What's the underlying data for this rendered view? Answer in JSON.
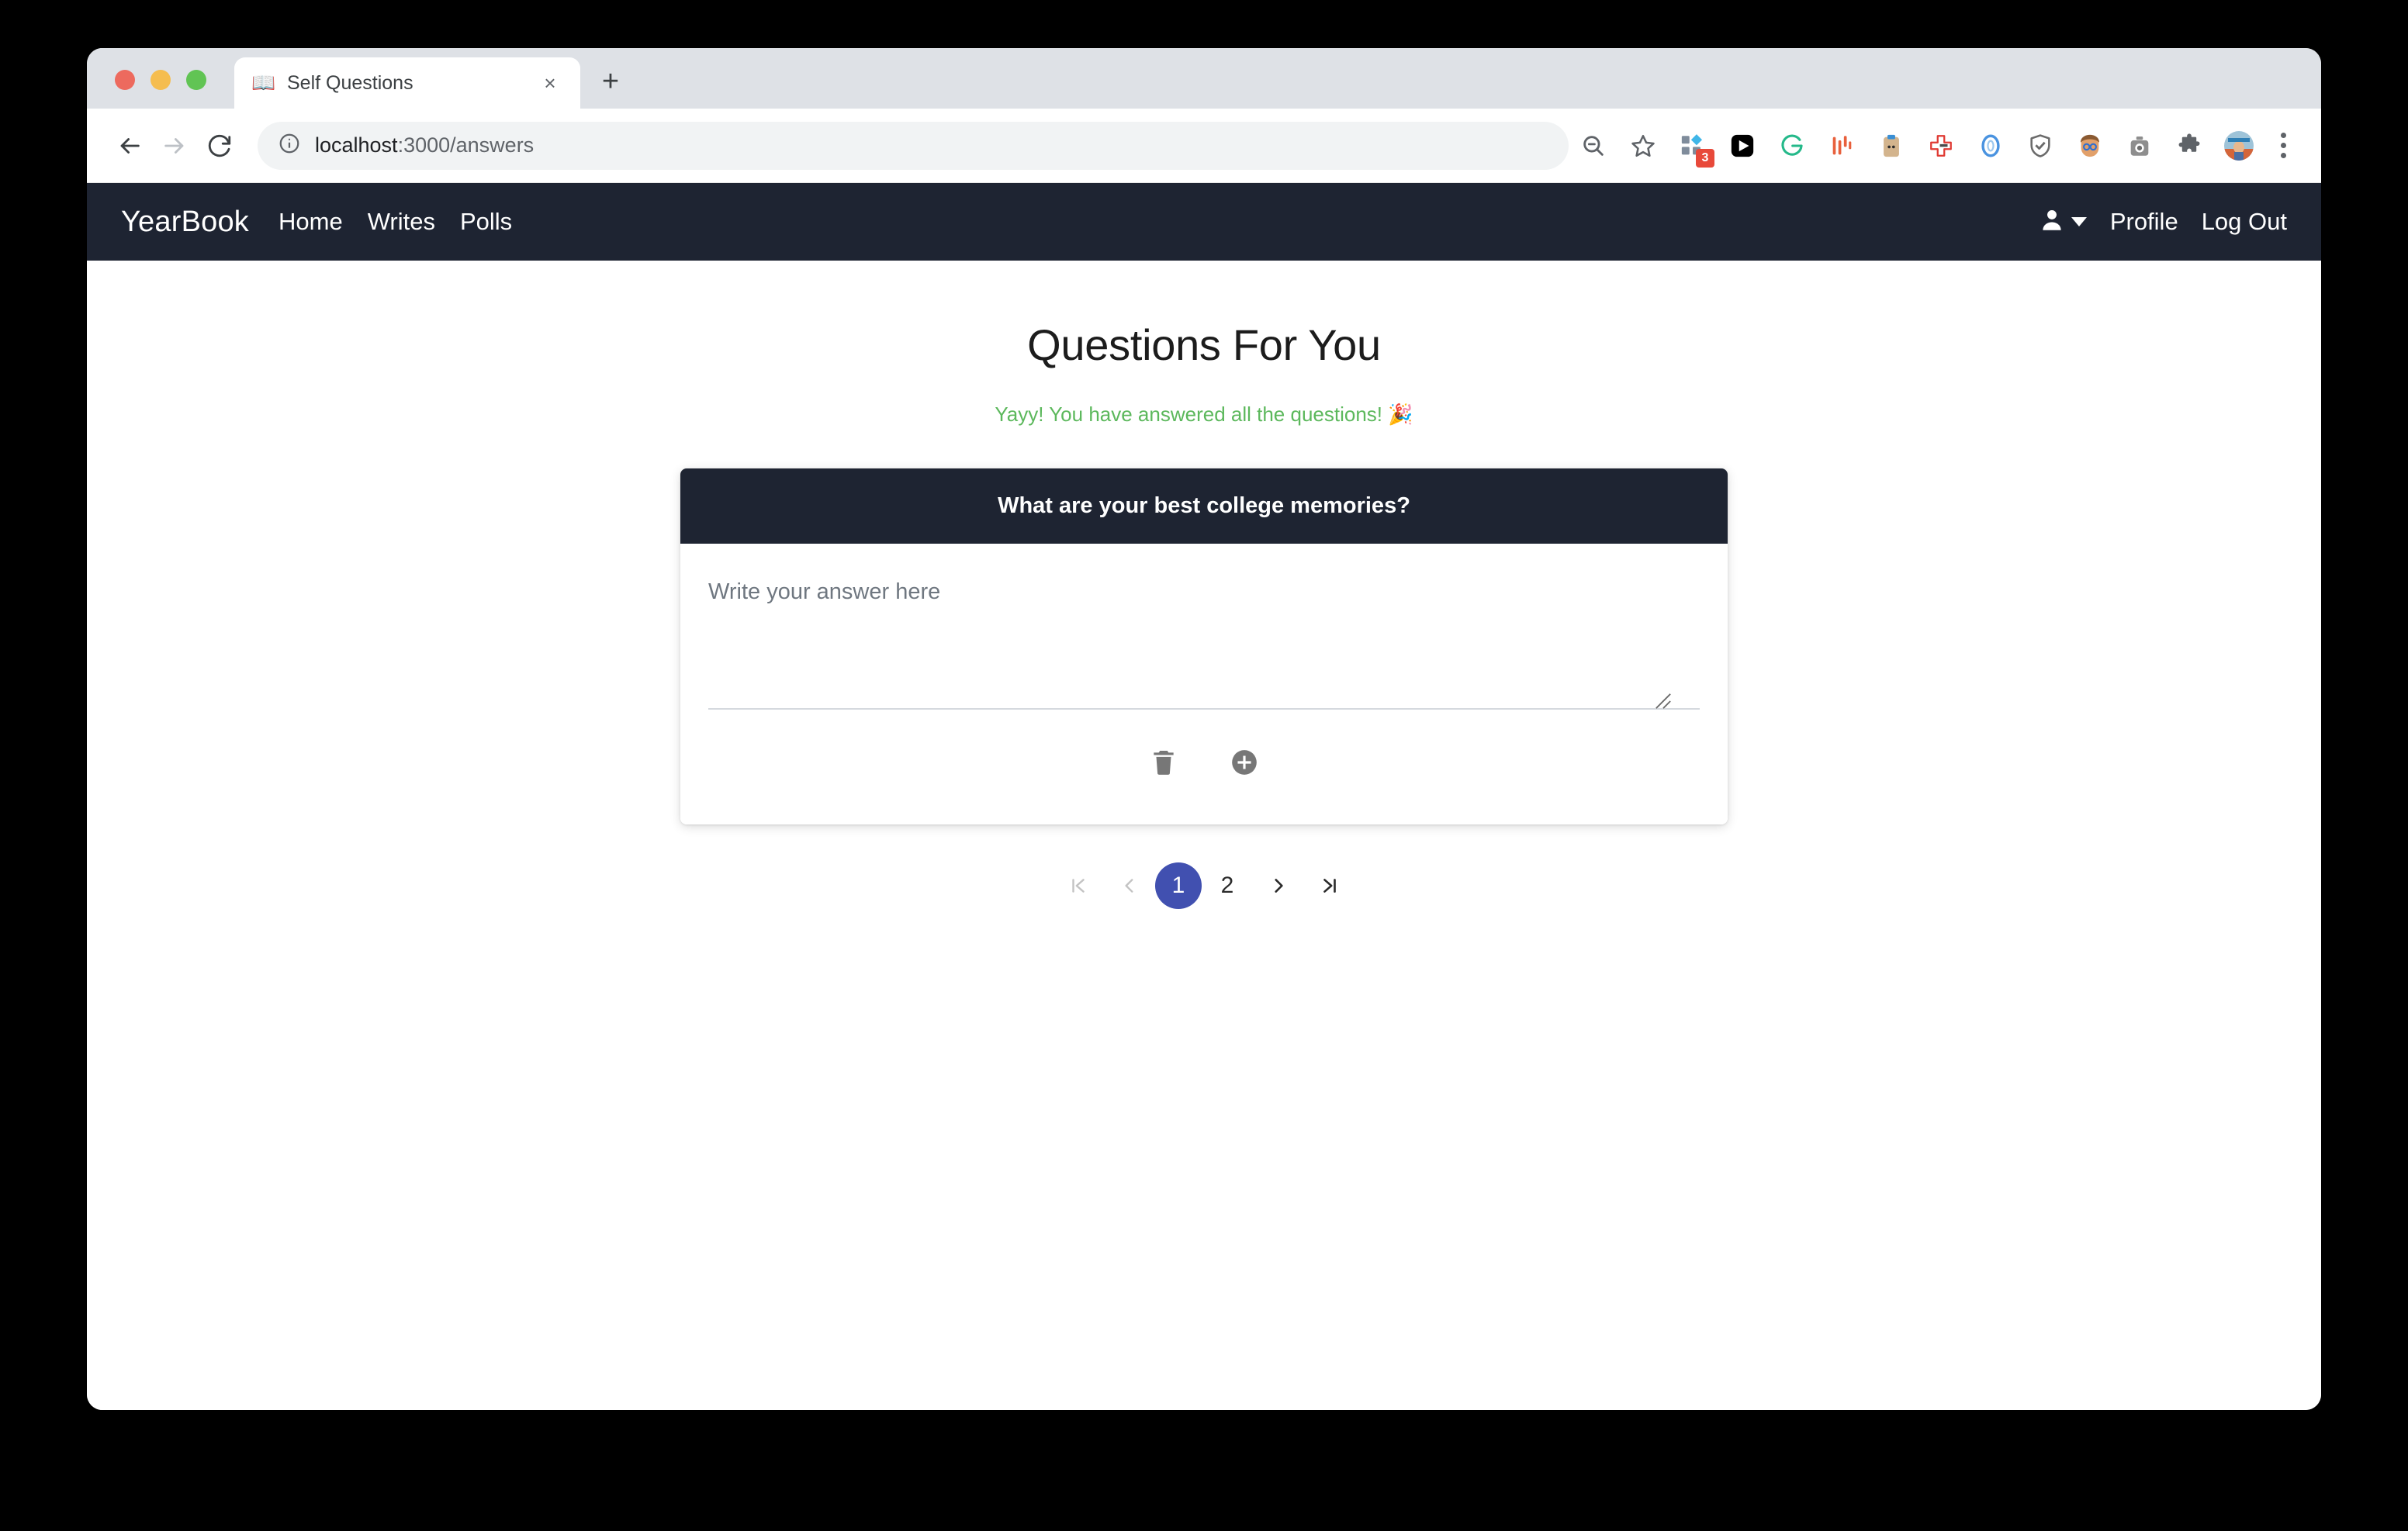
{
  "browser": {
    "traffic_lights": [
      "close",
      "minimize",
      "maximize"
    ],
    "tab": {
      "title": "Self Questions",
      "favicon": "📖",
      "close_label": "×"
    },
    "new_tab_label": "+",
    "back_icon": "back-arrow-icon",
    "forward_icon": "forward-arrow-icon",
    "reload_icon": "reload-icon",
    "omnibox": {
      "info_icon": "info-circle-icon",
      "host": "localhost",
      "path": ":3000/answers",
      "full_url": "localhost:3000/answers"
    },
    "extensions": [
      {
        "name": "zoom-out-icon",
        "glyph": "zoom"
      },
      {
        "name": "bookmark-star-icon",
        "glyph": "star"
      },
      {
        "name": "grid-extension-icon",
        "glyph": "grid",
        "badge": "3"
      },
      {
        "name": "video-play-extension-icon",
        "glyph": "play"
      },
      {
        "name": "grammarly-extension-icon",
        "glyph": "g"
      },
      {
        "name": "bars-extension-icon",
        "glyph": "bars"
      },
      {
        "name": "notes-extension-icon",
        "glyph": "notes"
      },
      {
        "name": "health-cross-extension-icon",
        "glyph": "cross"
      },
      {
        "name": "blue-ring-extension-icon",
        "glyph": "ring"
      },
      {
        "name": "shield-extension-icon",
        "glyph": "shield"
      },
      {
        "name": "face-avatar-extension-icon",
        "glyph": "face"
      },
      {
        "name": "camera-extension-icon",
        "glyph": "camera"
      },
      {
        "name": "puzzle-extensions-icon",
        "glyph": "puzzle"
      },
      {
        "name": "profile-avatar-icon",
        "glyph": "avatar"
      }
    ],
    "menu_icon": "three-dots-menu-icon"
  },
  "navbar": {
    "brand": "YearBook",
    "links": [
      {
        "label": "Home"
      },
      {
        "label": "Writes"
      },
      {
        "label": "Polls"
      }
    ],
    "user_icon": "user-person-icon",
    "profile_label": "Profile",
    "logout_label": "Log Out"
  },
  "main": {
    "title": "Questions For You",
    "success_message": "Yayy! You have answered all the questions! 🎉",
    "card": {
      "question": "What are your best college memories?",
      "answer_value": "",
      "answer_placeholder": "Write your answer here",
      "delete_icon": "trash-icon",
      "add_icon": "plus-circle-icon"
    }
  },
  "pagination": {
    "first_label": "|<",
    "prev_label": "<",
    "pages": [
      {
        "label": "1",
        "active": true
      },
      {
        "label": "2",
        "active": false
      }
    ],
    "next_label": ">",
    "last_label": ">|",
    "active_color": "#4150b0"
  },
  "colors": {
    "navbar_bg": "#1e2432",
    "success_green": "#5cb85c",
    "accent_indigo": "#4150b0"
  }
}
